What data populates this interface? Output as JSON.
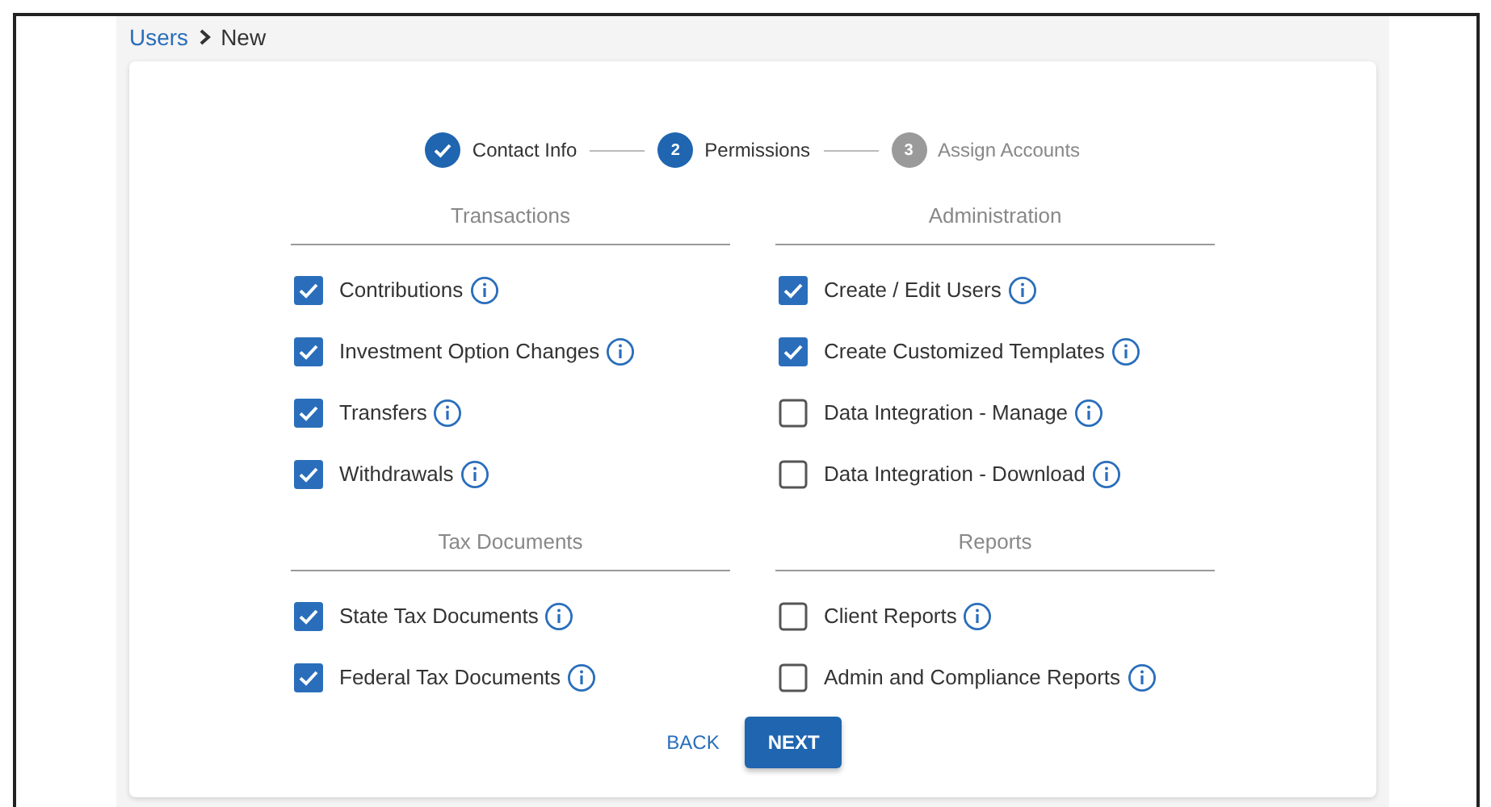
{
  "breadcrumb": [
    {
      "label": "Users",
      "kind": "link"
    },
    {
      "label": "New",
      "kind": "current"
    }
  ],
  "steps": [
    {
      "label": "Contact Info",
      "completed": true,
      "selected": false
    },
    {
      "number": "2",
      "label": "Permissions",
      "completed": false,
      "selected": true
    },
    {
      "number": "3",
      "label": "Assign Accounts",
      "completed": false,
      "selected": false
    }
  ],
  "sections": [
    {
      "title": "Transactions",
      "items": [
        {
          "label": "Contributions",
          "checked": true
        },
        {
          "label": "Investment Option Changes",
          "checked": true
        },
        {
          "label": "Transfers",
          "checked": true
        },
        {
          "label": "Withdrawals",
          "checked": true
        }
      ]
    },
    {
      "title": "Administration",
      "items": [
        {
          "label": "Create / Edit Users",
          "checked": true
        },
        {
          "label": "Create Customized Templates",
          "checked": true
        },
        {
          "label": "Data Integration - Manage",
          "checked": false
        },
        {
          "label": "Data Integration - Download",
          "checked": false
        }
      ]
    },
    {
      "title": "Tax Documents",
      "items": [
        {
          "label": "State Tax Documents",
          "checked": true
        },
        {
          "label": "Federal Tax Documents",
          "checked": true
        }
      ]
    },
    {
      "title": "Reports",
      "items": [
        {
          "label": "Client Reports",
          "checked": false
        },
        {
          "label": "Admin and Compliance Reports",
          "checked": false
        }
      ]
    }
  ],
  "buttons": [
    {
      "label": "BACK",
      "kind": "text"
    },
    {
      "label": "NEXT",
      "kind": "primary"
    }
  ]
}
